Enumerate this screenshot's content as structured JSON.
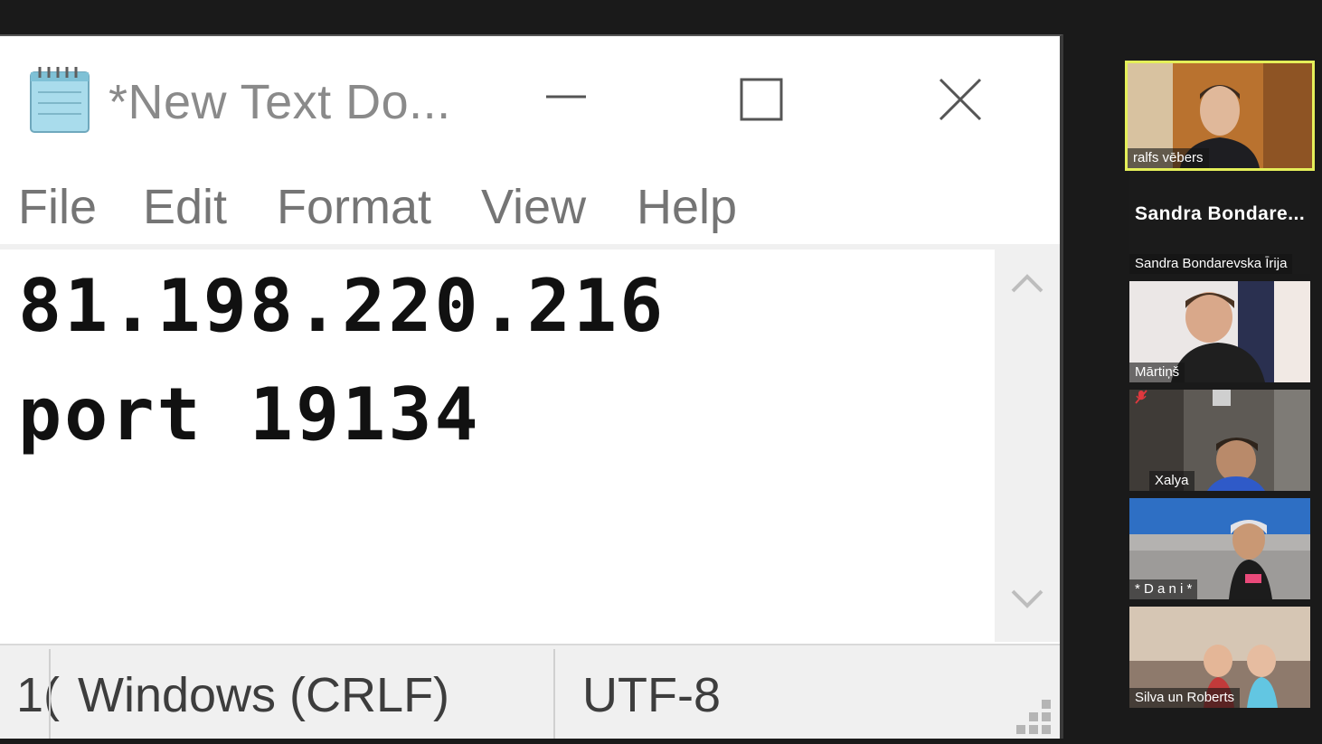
{
  "window": {
    "title": "*New Text Do...",
    "icon": "notepad-icon",
    "controls": {
      "minimize": "minimize-icon",
      "maximize": "maximize-icon",
      "close": "close-icon"
    }
  },
  "menu": {
    "items": [
      {
        "label": "File"
      },
      {
        "label": "Edit"
      },
      {
        "label": "Format"
      },
      {
        "label": "View"
      },
      {
        "label": "Help"
      }
    ]
  },
  "editor": {
    "lines": [
      "81.198.220.216",
      "port 19134"
    ]
  },
  "statusbar": {
    "position": "1(",
    "line_ending": "Windows (CRLF)",
    "encoding": "UTF-8"
  },
  "participants": [
    {
      "name": "ralfs vēbers",
      "active": true
    },
    {
      "name": "Sandra Bondarevska Īrija",
      "display_name": "Sandra  Bondare...",
      "video": false
    },
    {
      "name": "Mārtiņš"
    },
    {
      "name": "Xalya",
      "muted": true
    },
    {
      "name": "* D a n i *"
    },
    {
      "name": "Silva un Roberts"
    }
  ],
  "colors": {
    "active_speaker_border": "#e4ef59",
    "muted_icon": "#e0383e"
  }
}
